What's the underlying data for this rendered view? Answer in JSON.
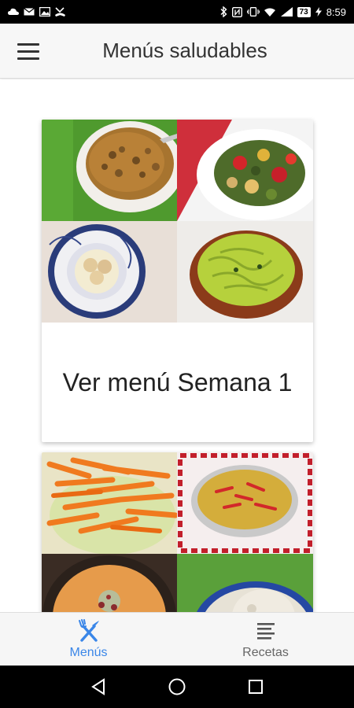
{
  "status_bar": {
    "time": "8:59",
    "battery": "73",
    "icons": [
      "cloud-icon",
      "mail-icon",
      "image-icon",
      "missed-call-icon",
      "bluetooth-icon",
      "nfc-icon",
      "vibrate-icon",
      "wifi-icon",
      "signal-icon",
      "battery-icon",
      "charging-icon"
    ]
  },
  "app_bar": {
    "title": "Menús saludables",
    "menu_icon": "hamburger-menu-icon"
  },
  "cards": [
    {
      "label": "Ver menú Semana 1",
      "photos": [
        "lentil-stew-photo",
        "ratatouille-photo",
        "scallops-plate-photo",
        "noodles-bowl-photo"
      ]
    },
    {
      "label": "",
      "photos": [
        "carrot-salad-photo",
        "paella-dish-photo",
        "cream-soup-photo",
        "stuffed-food-photo"
      ]
    }
  ],
  "bottom_nav": {
    "items": [
      {
        "label": "Menús",
        "icon": "fork-knife-icon",
        "active": true
      },
      {
        "label": "Recetas",
        "icon": "list-lines-icon",
        "active": false
      }
    ],
    "active_color": "#3a86e8",
    "inactive_color": "#666666"
  },
  "system_nav": {
    "buttons": [
      "back-icon",
      "home-icon",
      "recents-icon"
    ]
  }
}
